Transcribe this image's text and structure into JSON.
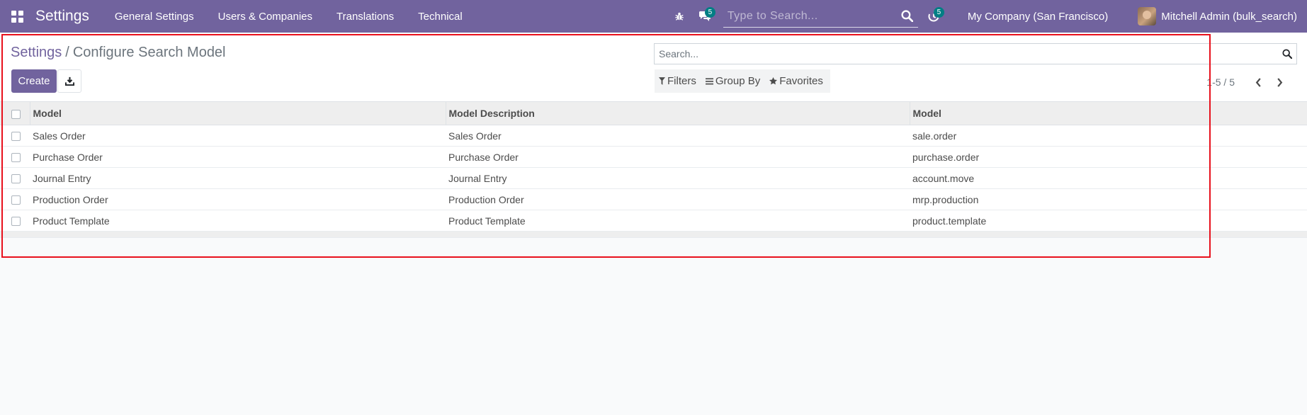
{
  "navbar": {
    "brand": "Settings",
    "menu": [
      "General Settings",
      "Users & Companies",
      "Translations",
      "Technical"
    ],
    "chat_badge": "5",
    "activity_badge": "5",
    "search_placeholder": "Type to Search...",
    "company": "My Company (San Francisco)",
    "user": "Mitchell Admin (bulk_search)"
  },
  "control": {
    "breadcrumb_parent": "Settings",
    "breadcrumb_separator": "/",
    "breadcrumb_current": "Configure Search Model",
    "create_label": "Create",
    "search_placeholder": "Search...",
    "filters_label": "Filters",
    "groupby_label": "Group By",
    "favorites_label": "Favorites",
    "pager": "1-5 / 5"
  },
  "table": {
    "columns": [
      "Model",
      "Model Description",
      "Model"
    ],
    "rows": [
      [
        "Sales Order",
        "Sales Order",
        "sale.order"
      ],
      [
        "Purchase Order",
        "Purchase Order",
        "purchase.order"
      ],
      [
        "Journal Entry",
        "Journal Entry",
        "account.move"
      ],
      [
        "Production Order",
        "Production Order",
        "mrp.production"
      ],
      [
        "Product Template",
        "Product Template",
        "product.template"
      ]
    ]
  },
  "colors": {
    "navbar": "#71639e",
    "primary": "#71639e",
    "badge": "#017e84",
    "highlight": "#e8101c"
  },
  "icons": [
    "apps-grid-icon",
    "bug-icon",
    "chat-icon",
    "search-icon",
    "clock-icon",
    "download-icon",
    "filter-icon",
    "bars-icon",
    "star-icon",
    "chevron-left-icon",
    "chevron-right-icon"
  ]
}
